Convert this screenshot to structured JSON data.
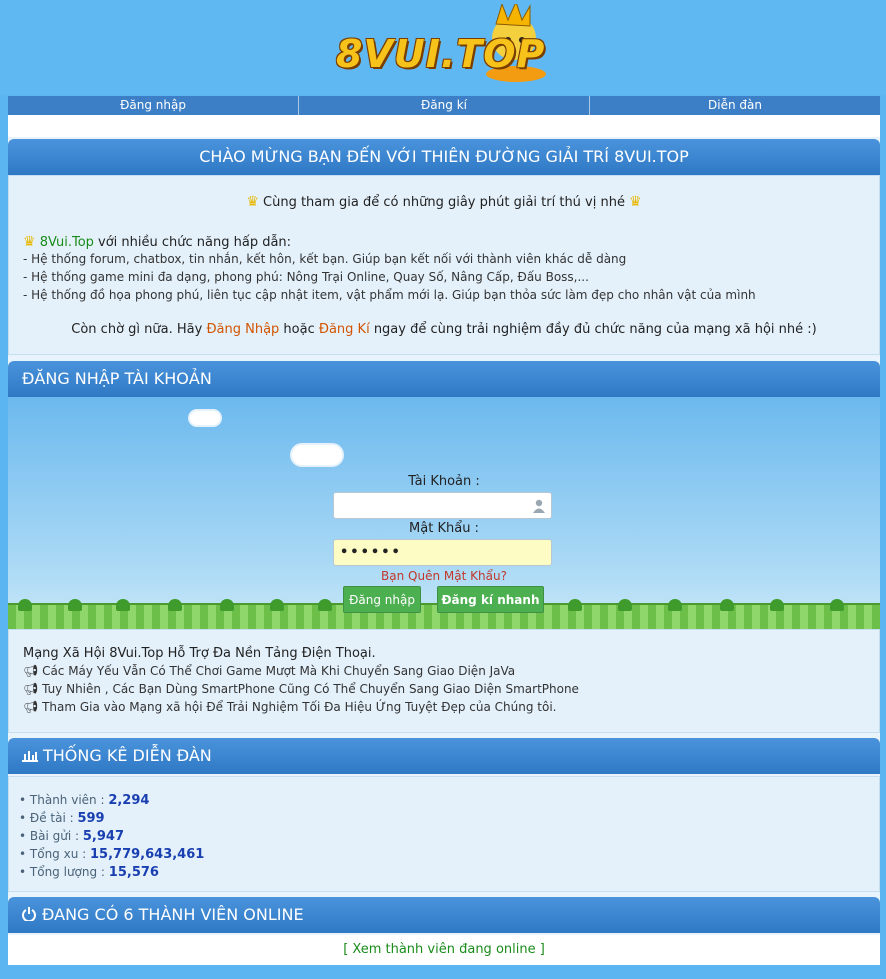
{
  "header": {
    "logo_text": "8VUI.TOP"
  },
  "nav": {
    "items": [
      "Đăng nhập",
      "Đăng kí",
      "Diễn đàn"
    ]
  },
  "welcome": {
    "title": "CHÀO MỪNG BẠN ĐẾN VỚI THIÊN ĐƯỜNG GIẢI TRÍ 8VUI.TOP",
    "tagline": "Cùng tham gia để có những giây phút giải trí thú vị nhé",
    "features_brand": "8Vui.Top",
    "features_title_rest": " với nhiều chức năng hấp dẫn:",
    "features": [
      "- Hệ thống forum, chatbox, tin nhắn, kết hôn, kết bạn. Giúp bạn kết nối với thành viên khác dễ dàng",
      "- Hệ thống game mini đa dạng, phong phú: Nông Trại Online, Quay Số, Nâng Cấp, Đấu Boss,...",
      "- Hệ thống đồ họa phong phú, liên tục cập nhật item, vật phẩm mới lạ. Giúp bạn thỏa sức làm đẹp cho nhân vật của mình"
    ],
    "cta_pre": "Còn chờ gì nữa. Hãy ",
    "cta_login": "Đăng Nhập",
    "cta_mid": " hoặc ",
    "cta_register": "Đăng Kí",
    "cta_post": " ngay để cùng trải nghiệm đầy đủ chức năng của mạng xã hội nhé :)"
  },
  "login": {
    "title": "ĐĂNG NHẬP TÀI KHOẢN",
    "username_label": "Tài Khoản :",
    "username_value": "",
    "password_label": "Mật Khẩu :",
    "password_value": "••••••",
    "forgot": "Bạn Quên Mật Khẩu?",
    "login_button": "Đăng nhập",
    "register_button": "Đăng kí nhanh"
  },
  "mobile": {
    "title": "Mạng Xã Hội 8Vui.Top Hỗ Trợ Đa Nền Tảng Điện Thoại.",
    "lines": [
      "Các Máy Yếu Vẫn Có Thể Chơi Game Mượt Mà Khi Chuyển Sang Giao Diện JaVa",
      "Tuy Nhiên , Các Bạn Dùng SmartPhone Cũng Có Thể Chuyển Sang Giao Diện SmartPhone",
      "Tham Gia vào Mạng xã hội Để Trải Nghiệm Tối Đa Hiệu Ứng Tuyệt Đẹp của Chúng tôi."
    ]
  },
  "stats": {
    "title": "THỐNG KÊ DIỄN ĐÀN",
    "items": [
      {
        "label": "Thành viên : ",
        "value": "2,294"
      },
      {
        "label": "Đề tài : ",
        "value": "599"
      },
      {
        "label": "Bài gửi : ",
        "value": "5,947"
      },
      {
        "label": "Tổng xu : ",
        "value": "15,779,643,461"
      },
      {
        "label": "Tổng lượng : ",
        "value": "15,576"
      }
    ]
  },
  "online": {
    "title": "ĐANG CÓ 6 THÀNH VIÊN ONLINE",
    "link": "[ Xem thành viên đang online ]"
  },
  "colors": {
    "accent": "#3d7fc6",
    "button_green": "#4caf50",
    "link_orange": "#d35400"
  }
}
